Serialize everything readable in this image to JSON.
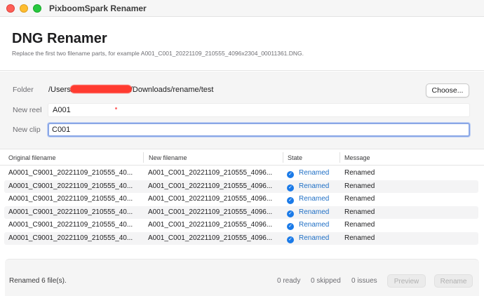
{
  "window": {
    "title": "PixboomSpark Renamer"
  },
  "header": {
    "title": "DNG Renamer",
    "subtitle": "Replace the first two filename parts, for example A001_C001_20221109_210555_4096x2304_00011361.DNG."
  },
  "form": {
    "folder_label": "Folder",
    "folder_path_prefix": "/Users/",
    "folder_path_suffix": "/Downloads/rename/test",
    "choose_label": "Choose...",
    "reel_label": "New reel",
    "reel_value": "A001",
    "clip_label": "New clip",
    "clip_value": "C001"
  },
  "table": {
    "columns": [
      "Original filename",
      "New filename",
      "State",
      "Message"
    ],
    "rows": [
      {
        "original": "A0001_C9001_20221109_210555_40...",
        "new": "A001_C001_20221109_210555_4096...",
        "state": "Renamed",
        "message": "Renamed"
      },
      {
        "original": "A0001_C9001_20221109_210555_40...",
        "new": "A001_C001_20221109_210555_4096...",
        "state": "Renamed",
        "message": "Renamed"
      },
      {
        "original": "A0001_C9001_20221109_210555_40...",
        "new": "A001_C001_20221109_210555_4096...",
        "state": "Renamed",
        "message": "Renamed"
      },
      {
        "original": "A0001_C9001_20221109_210555_40...",
        "new": "A001_C001_20221109_210555_4096...",
        "state": "Renamed",
        "message": "Renamed"
      },
      {
        "original": "A0001_C9001_20221109_210555_40...",
        "new": "A001_C001_20221109_210555_4096...",
        "state": "Renamed",
        "message": "Renamed"
      },
      {
        "original": "A0001_C9001_20221109_210555_40...",
        "new": "A001_C001_20221109_210555_4096...",
        "state": "Renamed",
        "message": "Renamed"
      }
    ]
  },
  "footer": {
    "status": "Renamed 6 file(s).",
    "ready": "0 ready",
    "skipped": "0 skipped",
    "issues": "0 issues",
    "preview_label": "Preview",
    "rename_label": "Rename"
  },
  "icons": {
    "state_icon": "checkmark-circle-icon",
    "redaction": "red-redaction-mark"
  },
  "colors": {
    "accent": "#1a7ae8",
    "focus_ring": "#8aa7e6",
    "redaction": "#ff3b30"
  }
}
